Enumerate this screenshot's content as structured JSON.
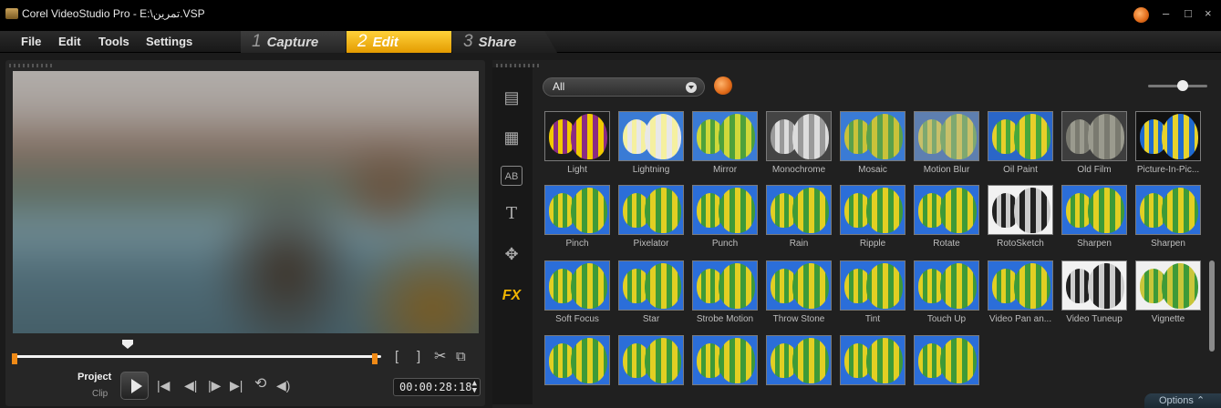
{
  "window": {
    "title": "Corel VideoStudio Pro - E:\\تمرين.VSP",
    "controls": [
      "–",
      "□",
      "×"
    ]
  },
  "menu": {
    "items": [
      "File",
      "Edit",
      "Tools",
      "Settings"
    ]
  },
  "steps": [
    {
      "num": "1",
      "label": "Capture"
    },
    {
      "num": "2",
      "label": "Edit"
    },
    {
      "num": "3",
      "label": "Share"
    }
  ],
  "player": {
    "mode_project": "Project",
    "mode_clip": "Clip",
    "timecode": "00:00:28:18",
    "mark_in": "[",
    "mark_out": "]"
  },
  "library": {
    "filter_value": "All",
    "options_label": "Options",
    "categories": [
      "media-icon",
      "transition-icon",
      "title-ab-icon",
      "text-t-icon",
      "graphic-icon",
      "fx-icon"
    ],
    "fx_label": "FX",
    "filters": [
      "Light",
      "Lightning",
      "Mirror",
      "Monochrome",
      "Mosaic",
      "Motion Blur",
      "Oil Paint",
      "Old Film",
      "Picture-In-Pic...",
      "Pinch",
      "Pixelator",
      "Punch",
      "Rain",
      "Ripple",
      "Rotate",
      "RotoSketch",
      "Sharpen",
      "Sharpen",
      "Soft Focus",
      "Star",
      "Strobe Motion",
      "Throw Stone",
      "Tint",
      "Touch Up",
      "Video Pan an...",
      "Video Tuneup",
      "Vignette",
      "",
      "",
      "",
      "",
      "",
      ""
    ]
  }
}
